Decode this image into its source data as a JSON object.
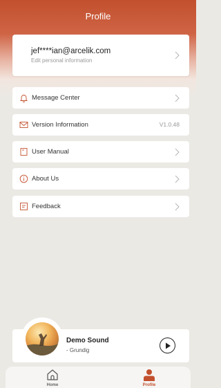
{
  "header": {
    "title": "Profile"
  },
  "account": {
    "email": "jef****ian@arcelik.com",
    "subtitle": "Edit personal information"
  },
  "menu": [
    {
      "label": "Message Center",
      "icon": "bell-icon",
      "value": ""
    },
    {
      "label": "Version Information",
      "icon": "mail-icon",
      "value": "V1.0.48"
    },
    {
      "label": "User Manual",
      "icon": "book-icon",
      "value": ""
    },
    {
      "label": "About Us",
      "icon": "info-icon",
      "value": ""
    },
    {
      "label": "Feedback",
      "icon": "feedback-icon",
      "value": ""
    }
  ],
  "player": {
    "title": "Demo Sound",
    "artist": "- Grundig"
  },
  "tabbar": {
    "home_label": "Home",
    "profile_label": "Profile"
  },
  "colors": {
    "accent": "#c2502e",
    "background": "#ebe9e4",
    "icon": "#c2502e"
  }
}
